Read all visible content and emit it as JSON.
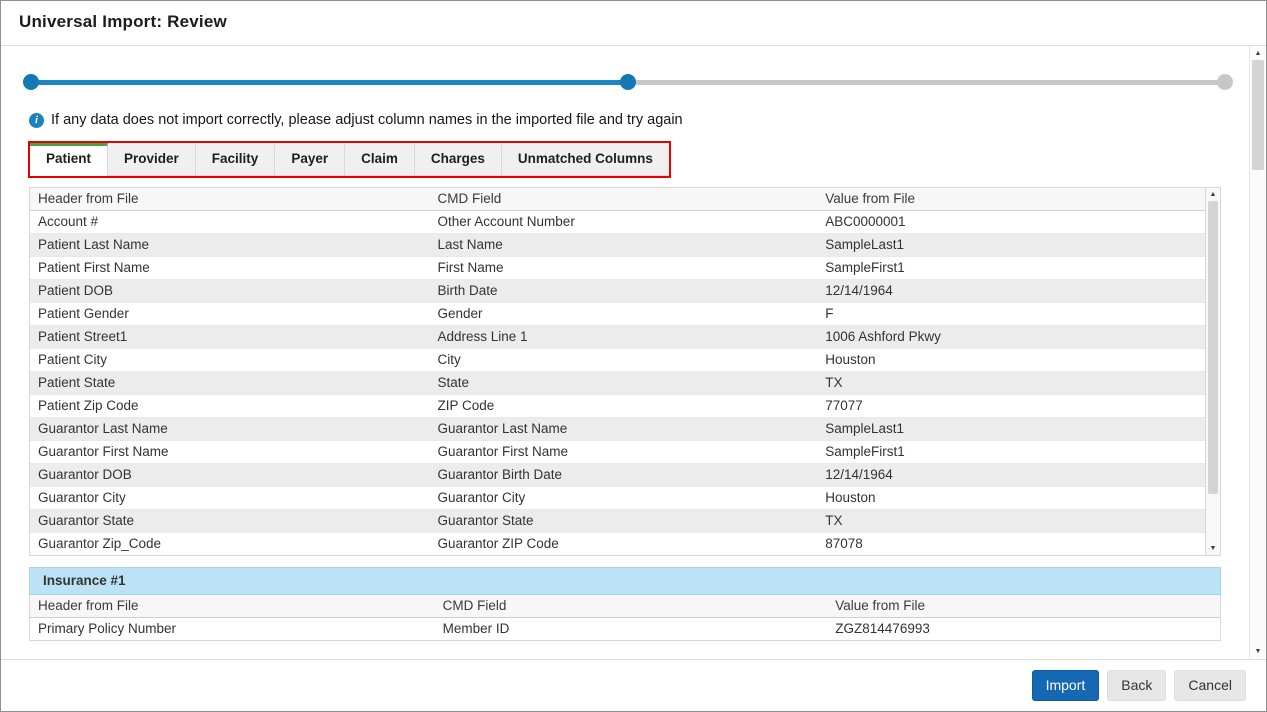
{
  "window": {
    "title": "Universal Import: Review"
  },
  "progress": {
    "total_steps": 3,
    "current_step": 2
  },
  "info_banner": {
    "icon": "info-circle-icon",
    "icon_glyph": "i",
    "text": "If any data does not import correctly, please adjust column names in the imported file and try again"
  },
  "tabs": [
    {
      "label": "Patient",
      "active": true
    },
    {
      "label": "Provider",
      "active": false
    },
    {
      "label": "Facility",
      "active": false
    },
    {
      "label": "Payer",
      "active": false
    },
    {
      "label": "Claim",
      "active": false
    },
    {
      "label": "Charges",
      "active": false
    },
    {
      "label": "Unmatched Columns",
      "active": false
    }
  ],
  "mapping_table": {
    "columns": [
      "Header from File",
      "CMD Field",
      "Value from File"
    ],
    "rows": [
      [
        "Account #",
        "Other Account Number",
        "ABC0000001"
      ],
      [
        "Patient Last Name",
        "Last Name",
        "SampleLast1"
      ],
      [
        "Patient First Name",
        "First Name",
        "SampleFirst1"
      ],
      [
        "Patient DOB",
        "Birth Date",
        "12/14/1964"
      ],
      [
        "Patient Gender",
        "Gender",
        "F"
      ],
      [
        "Patient Street1",
        "Address Line 1",
        "1006 Ashford Pkwy"
      ],
      [
        "Patient City",
        "City",
        "Houston"
      ],
      [
        "Patient State",
        "State",
        "TX"
      ],
      [
        "Patient Zip Code",
        "ZIP Code",
        "77077"
      ],
      [
        "Guarantor Last Name",
        "Guarantor Last Name",
        "SampleLast1"
      ],
      [
        "Guarantor First Name",
        "Guarantor First Name",
        "SampleFirst1"
      ],
      [
        "Guarantor DOB",
        "Guarantor Birth Date",
        "12/14/1964"
      ],
      [
        "Guarantor City",
        "Guarantor City",
        "Houston"
      ],
      [
        "Guarantor State",
        "Guarantor State",
        "TX"
      ],
      [
        "Guarantor Zip_Code",
        "Guarantor ZIP Code",
        "87078"
      ]
    ]
  },
  "insurance_section": {
    "title": "Insurance #1",
    "columns": [
      "Header from File",
      "CMD Field",
      "Value from File"
    ],
    "rows": [
      [
        "Primary Policy Number",
        "Member ID",
        "ZGZ814476993"
      ]
    ]
  },
  "footer": {
    "buttons": [
      {
        "label": "Import",
        "primary": true
      },
      {
        "label": "Back",
        "primary": false
      },
      {
        "label": "Cancel",
        "primary": false
      }
    ]
  },
  "scrollbar": {
    "up_glyph": "▲",
    "down_glyph": "▼"
  },
  "colors": {
    "accent_blue": "#1c86c4",
    "active_tab_green": "#44a248",
    "annotation_red": "#ea0000",
    "insurance_band_blue": "#bce2f5",
    "primary_button_blue": "#1568b4",
    "inactive_gray": "#c7c7c7"
  }
}
